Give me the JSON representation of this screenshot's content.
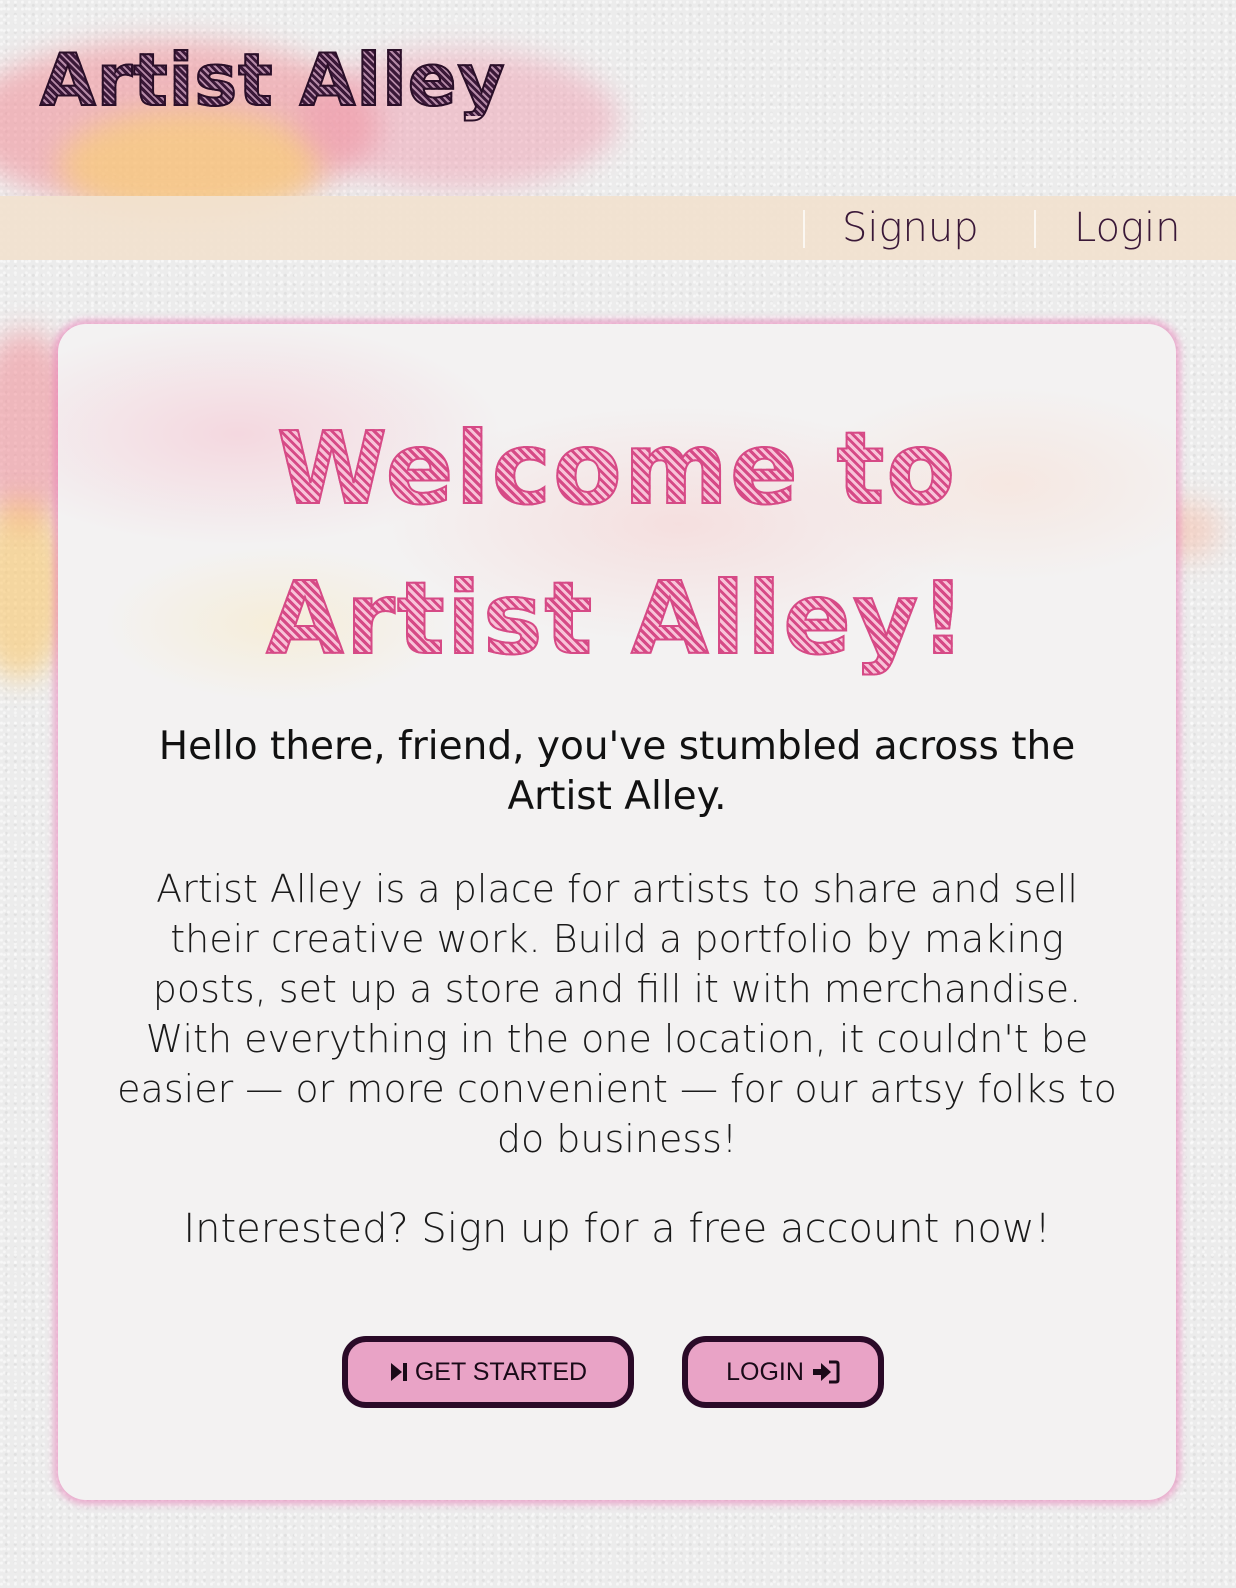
{
  "header": {
    "logo_text": "Artist Alley",
    "nav": {
      "signup_label": "Signup",
      "login_label": "Login"
    }
  },
  "main": {
    "welcome_line1": "Welcome to",
    "welcome_line2": "Artist Alley!",
    "hello_text": "Hello there, friend, you've stumbled across the Artist Alley.",
    "description": "Artist Alley is a place for artists to share and sell their creative work. Build a portfolio by making posts, set up a store and fill it with merchandise. With everything in the one location, it couldn't be easier — or more convenient — for our artsy folks to do business!",
    "cta_text": "Interested? Sign up for a free account now!",
    "buttons": {
      "get_started_label": "GET STARTED",
      "get_started_icon": "step-forward-icon",
      "login_label": "LOGIN",
      "login_icon": "sign-in-icon"
    }
  },
  "colors": {
    "accent_pink": "#d64a86",
    "button_fill": "#e9a3c6",
    "button_border": "#2a0a28",
    "nav_bar": "#f1e2d0",
    "text_dark": "#3a1838"
  }
}
